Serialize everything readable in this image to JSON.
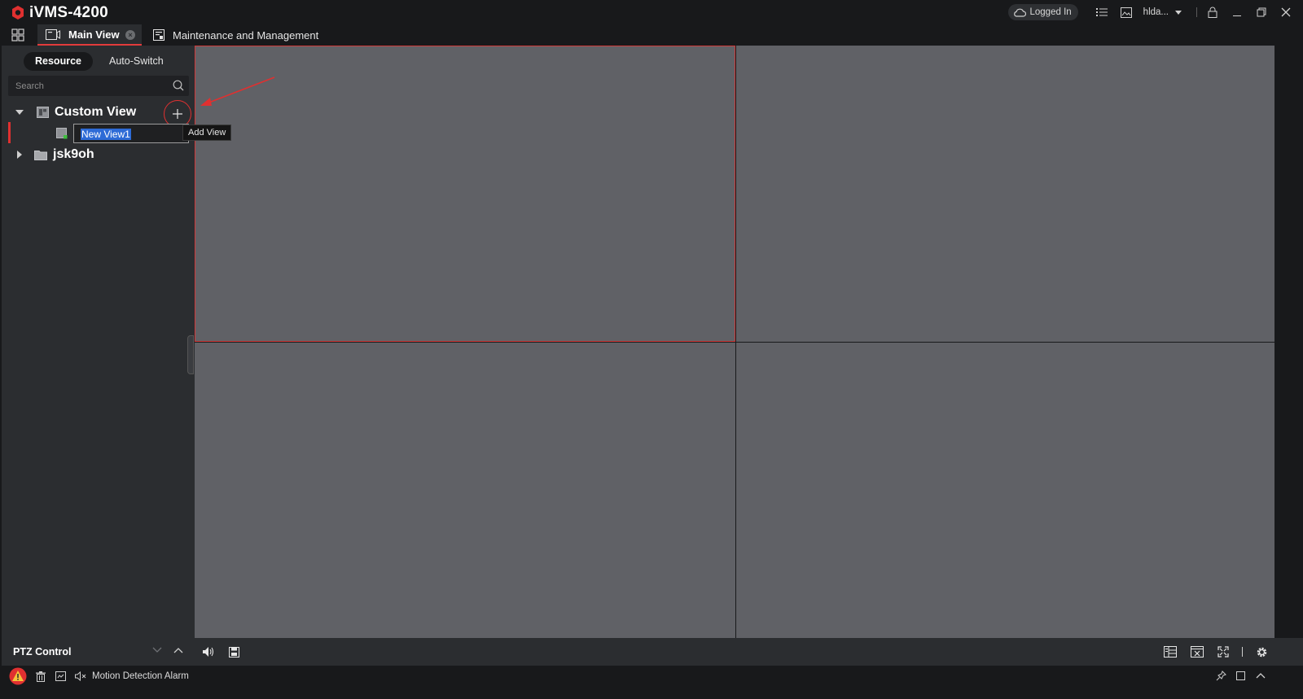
{
  "app": {
    "title": "iVMS-4200",
    "brand_color": "#e03030"
  },
  "titlebar": {
    "login_status": "Logged In",
    "user": "hlda..."
  },
  "tabs": {
    "main_view": "Main View",
    "maintenance": "Maintenance and Management"
  },
  "left_panel": {
    "segments": [
      "Resource",
      "Auto-Switch"
    ],
    "active_segment": "Resource",
    "search_placeholder": "Search",
    "tree": {
      "custom_view": "Custom View",
      "new_view_editing": "New View1",
      "group": "jsk9oh"
    },
    "tooltip": "Add View"
  },
  "ptz": {
    "label": "PTZ Control"
  },
  "statusbar": {
    "alarm_text": "Motion Detection Alarm"
  },
  "icons": {
    "titlebar": [
      "cloud-icon",
      "list-icon",
      "image-icon",
      "lock-icon",
      "minimize-icon",
      "restore-icon",
      "close-icon"
    ],
    "controls_left": [
      "volume-icon",
      "save-icon"
    ],
    "controls_right": [
      "layout-icon",
      "stop-all-icon",
      "fullscreen-icon",
      "settings-icon"
    ]
  }
}
